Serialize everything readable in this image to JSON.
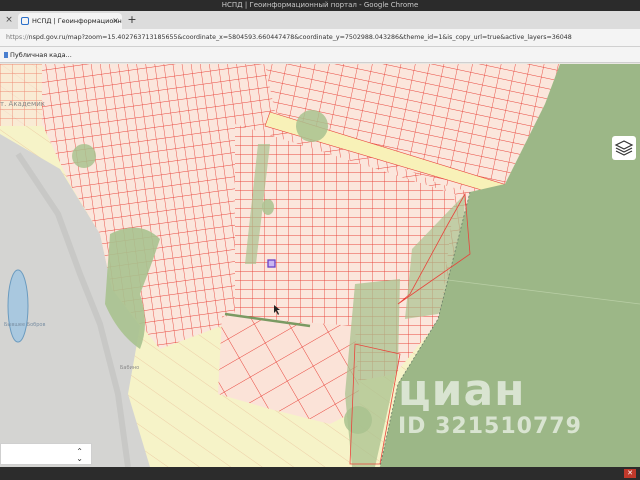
{
  "window": {
    "title": "НСПД | Геоинформационный портал - Google Chrome"
  },
  "tab": {
    "title": "НСПД | Геоинформационн",
    "close_icon": "close-icon",
    "favicon": "map-favicon"
  },
  "toolbar": {
    "new_tab_label": "+",
    "close_window_label": "×"
  },
  "address": {
    "scheme": "https://",
    "rest": "nspd.gov.ru/map?zoom=15.402763713185655&coordinate_x=5804593.660447478&coordinate_y=7502988.043286&theme_id=1&is_copy_url=true&active_layers=36048"
  },
  "bookmarks": [
    {
      "label": "Публичная када..."
    }
  ],
  "map": {
    "labels": [
      {
        "text": "т. Академик"
      },
      {
        "text": "Бывшее Бобров"
      },
      {
        "text": "Бабино"
      }
    ],
    "colors": {
      "background": "#f6f3c8",
      "parcel": "#e8453c",
      "parcel_fill": "#fbe6dc",
      "forest": "#a9c28f",
      "water": "#a9c8df",
      "sand": "#cfcfcf"
    }
  },
  "watermark": {
    "brand": "циан",
    "id": "ID 321510779"
  },
  "controls": {
    "layer_selector_arrows": "⌃⌄",
    "layers_icon": "layers-icon"
  },
  "tray": {
    "icon_label": "✕"
  }
}
